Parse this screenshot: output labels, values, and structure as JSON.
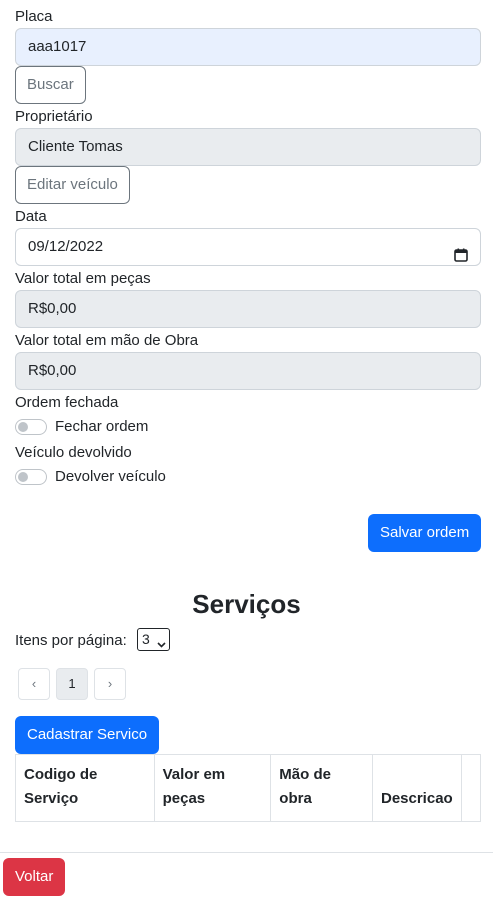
{
  "form": {
    "placa_label": "Placa",
    "placa_value": "aaa1017",
    "buscar_label": "Buscar",
    "proprietario_label": "Proprietário",
    "proprietario_value": "Cliente Tomas",
    "editar_veiculo_label": "Editar veículo",
    "data_label": "Data",
    "data_value": "09/12/2022",
    "valor_pecas_label": "Valor total em peças",
    "valor_pecas_value": "R$0,00",
    "valor_mao_obra_label": "Valor total em mão de Obra",
    "valor_mao_obra_value": "R$0,00",
    "ordem_fechada_label": "Ordem fechada",
    "fechar_ordem_label": "Fechar ordem",
    "fechar_ordem_checked": false,
    "veiculo_devolvido_label": "Veículo devolvido",
    "devolver_veiculo_label": "Devolver veículo",
    "devolver_veiculo_checked": false,
    "salvar_ordem_label": "Salvar ordem"
  },
  "servicos": {
    "title": "Serviços",
    "itens_por_pagina_label": "Itens por página:",
    "itens_por_pagina_value": "3",
    "pagination": {
      "prev": "‹",
      "current_page": "1",
      "next": "›"
    },
    "cadastrar_label": "Cadastrar Servico",
    "table": {
      "columns": [
        "Codigo de Serviço",
        "Valor em peças",
        "Mão de obra",
        "Descricao",
        ""
      ],
      "rows": []
    }
  },
  "footer": {
    "voltar_label": "Voltar"
  },
  "colors": {
    "primary": "#0d6efd",
    "danger": "#dc3545",
    "readonly_bg": "#e9ecef",
    "autofill_bg": "#e8f0fe"
  },
  "icons": {
    "date_picker": "calendar-icon",
    "select_arrow": "chevron-down-icon"
  }
}
